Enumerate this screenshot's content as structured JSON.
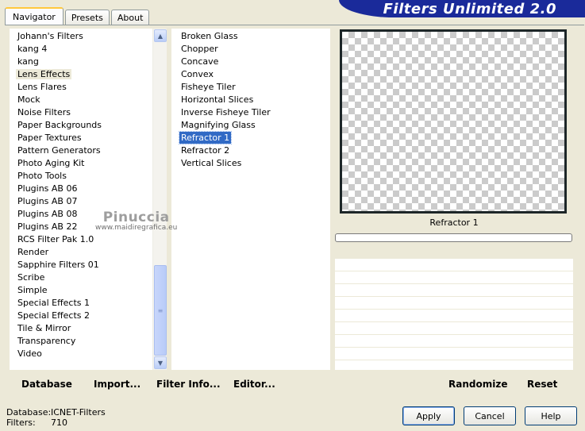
{
  "tabs": [
    {
      "label": "Navigator",
      "active": true
    },
    {
      "label": "Presets",
      "active": false
    },
    {
      "label": "About",
      "active": false
    }
  ],
  "banner_title": "Filters Unlimited 2.0",
  "categories": [
    {
      "label": "Johann's Filters"
    },
    {
      "label": "kang 4"
    },
    {
      "label": "kang"
    },
    {
      "label": "Lens Effects",
      "selected": true
    },
    {
      "label": "Lens Flares"
    },
    {
      "label": "Mock"
    },
    {
      "label": "Noise Filters"
    },
    {
      "label": "Paper Backgrounds"
    },
    {
      "label": "Paper Textures"
    },
    {
      "label": "Pattern Generators"
    },
    {
      "label": "Photo Aging Kit"
    },
    {
      "label": "Photo Tools"
    },
    {
      "label": "Plugins AB 06"
    },
    {
      "label": "Plugins AB 07"
    },
    {
      "label": "Plugins AB 08"
    },
    {
      "label": "Plugins AB 22"
    },
    {
      "label": "RCS Filter Pak 1.0"
    },
    {
      "label": "Render"
    },
    {
      "label": "Sapphire Filters 01"
    },
    {
      "label": "Scribe"
    },
    {
      "label": "Simple"
    },
    {
      "label": "Special Effects 1"
    },
    {
      "label": "Special Effects 2"
    },
    {
      "label": "Tile & Mirror"
    },
    {
      "label": "Transparency"
    },
    {
      "label": "Video"
    }
  ],
  "filters": [
    {
      "label": "Broken Glass"
    },
    {
      "label": "Chopper"
    },
    {
      "label": "Concave"
    },
    {
      "label": "Convex"
    },
    {
      "label": "Fisheye Tiler"
    },
    {
      "label": "Horizontal Slices"
    },
    {
      "label": "Inverse Fisheye Tiler"
    },
    {
      "label": "Magnifying Glass"
    },
    {
      "label": "Refractor 1",
      "selected": true
    },
    {
      "label": "Refractor 2"
    },
    {
      "label": "Vertical Slices"
    }
  ],
  "watermark": {
    "name": "Pinuccia",
    "url": "www.maidiregrafica.eu"
  },
  "preview": {
    "filter_name": "Refractor 1",
    "progress": 0
  },
  "left_buttons": {
    "database": "Database",
    "import": "Import...",
    "filter_info": "Filter Info...",
    "editor": "Editor..."
  },
  "right_buttons": {
    "randomize": "Randomize",
    "reset": "Reset"
  },
  "status": {
    "database_label": "Database:",
    "database_value": "ICNET-Filters",
    "filters_label": "Filters:",
    "filters_value": "710"
  },
  "dialog_buttons": {
    "apply": "Apply",
    "cancel": "Cancel",
    "help": "Help"
  },
  "icons": {
    "scroll_up": "scroll-up-icon",
    "scroll_down": "scroll-down-icon",
    "grip": "scroll-grip-icon"
  }
}
